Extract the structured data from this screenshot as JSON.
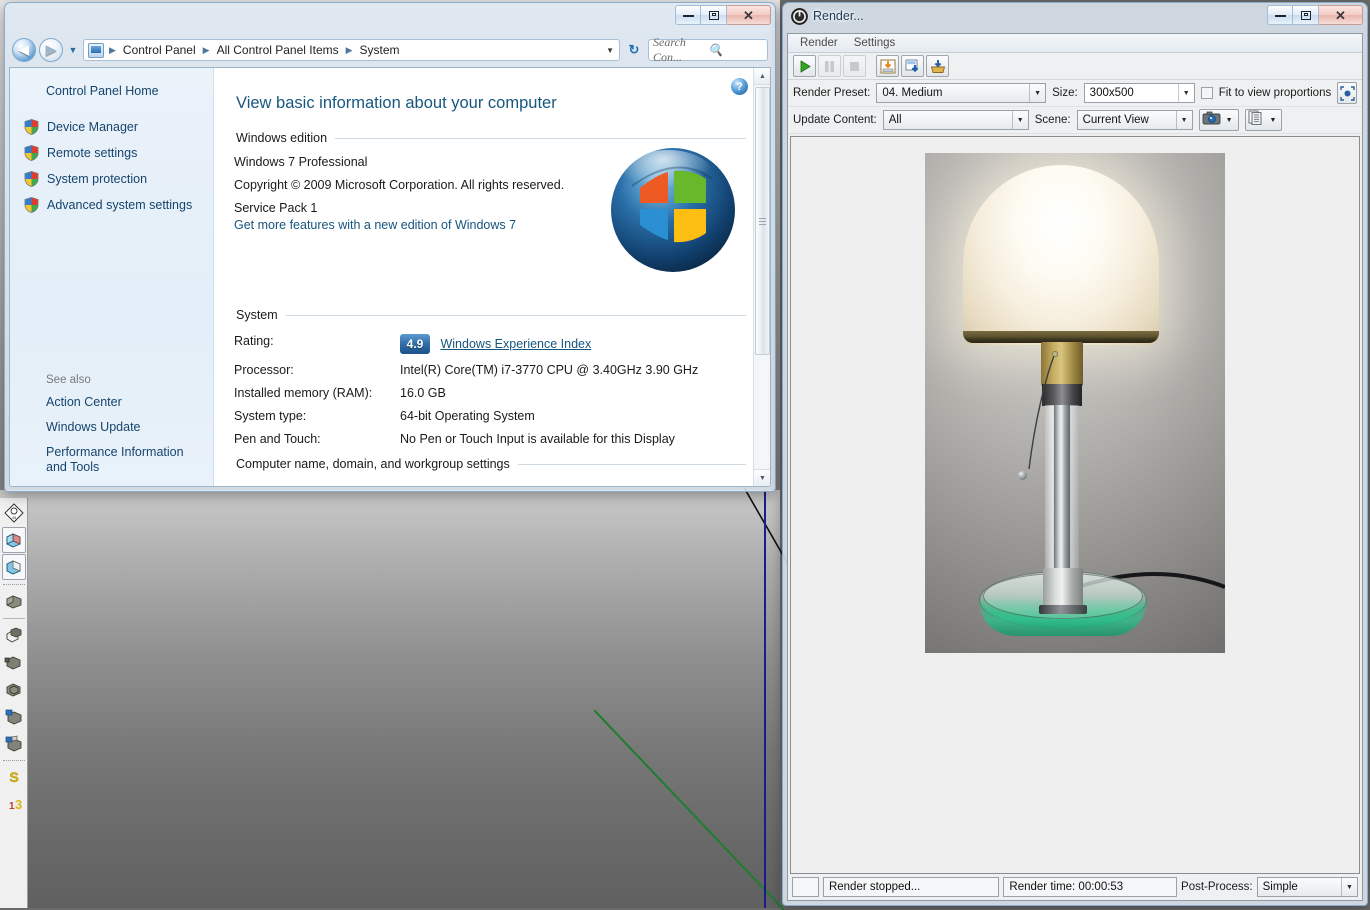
{
  "control_panel": {
    "window_title": "",
    "nav": {
      "back_label": "◀",
      "forward_label": "▶",
      "dropdown_label": "▼",
      "refresh_label": "↻",
      "breadcrumbs": [
        "Control Panel",
        "All Control Panel Items",
        "System"
      ],
      "separator": "▶",
      "caret": "▼"
    },
    "search": {
      "placeholder": "Search Con...",
      "value": "",
      "icon": "search-icon"
    },
    "window_buttons": {
      "minimize": "minimize-icon",
      "maximize": "maximize-icon",
      "close": "close-icon"
    },
    "sidebar": {
      "home_label": "Control Panel Home",
      "items": [
        {
          "label": "Device Manager",
          "icon": "shield-icon"
        },
        {
          "label": "Remote settings",
          "icon": "shield-icon"
        },
        {
          "label": "System protection",
          "icon": "shield-icon"
        },
        {
          "label": "Advanced system settings",
          "icon": "shield-icon"
        }
      ],
      "see_also_title": "See also",
      "see_also_links": [
        "Action Center",
        "Windows Update",
        "Performance Information and Tools"
      ]
    },
    "main": {
      "help_label": "?",
      "heading": "View basic information about your computer",
      "windows_edition": {
        "section_title": "Windows edition",
        "edition": "Windows 7 Professional",
        "copyright": "Copyright © 2009 Microsoft Corporation.  All rights reserved.",
        "service_pack": "Service Pack 1",
        "upgrade_link": "Get more features with a new edition of Windows 7"
      },
      "system": {
        "section_title": "System",
        "rows": [
          {
            "label": "Rating:",
            "value": "",
            "badge": "4.9",
            "link": "Windows Experience Index"
          },
          {
            "label": "Processor:",
            "value": "Intel(R) Core(TM) i7-3770 CPU @ 3.40GHz   3.90 GHz"
          },
          {
            "label": "Installed memory (RAM):",
            "value": "16.0 GB"
          },
          {
            "label": "System type:",
            "value": "64-bit Operating System"
          },
          {
            "label": "Pen and Touch:",
            "value": "No Pen or Touch Input is available for this Display"
          }
        ]
      },
      "computer_name_section": "Computer name, domain, and workgroup settings"
    },
    "scrollbar": {
      "up": "▲",
      "down": "▼"
    }
  },
  "render_window": {
    "title": "Render...",
    "icon": "power-icon",
    "window_buttons": {
      "minimize": "minimize-icon",
      "maximize": "maximize-icon",
      "close": "close-icon"
    },
    "menu": [
      "Render",
      "Settings"
    ],
    "toolbar": [
      {
        "name": "render-start-button",
        "icon": "play-icon"
      },
      {
        "name": "render-pause-button",
        "icon": "pause-icon"
      },
      {
        "name": "render-stop-button",
        "icon": "stop-icon"
      },
      {
        "name": "save-image-button",
        "icon": "save-image-icon"
      },
      {
        "name": "save-render-button",
        "icon": "save-render-icon"
      },
      {
        "name": "export-button",
        "icon": "export-icon"
      }
    ],
    "controls": {
      "render_preset_label": "Render Preset:",
      "render_preset_value": "04. Medium",
      "size_label": "Size:",
      "size_value": "300x500",
      "fit_to_view_label": "Fit to view proportions",
      "fit_to_view_checked": false,
      "lock_aspect_icon": "aspect-lock-icon",
      "update_content_label": "Update Content:",
      "update_content_value": "All",
      "scene_label": "Scene:",
      "scene_value": "Current View",
      "camera_button_icon": "camera-icon",
      "layers_button_icon": "layers-icon",
      "dropdown_caret": "▼"
    },
    "canvas": {
      "alt": "Rendered Wagenfeld Bauhaus table lamp"
    },
    "status": {
      "message": "Render stopped...",
      "render_time": "Render time: 00:00:53",
      "post_process_label": "Post-Process:",
      "post_process_value": "Simple"
    }
  },
  "background_app": {
    "toolbar_tools": [
      {
        "name": "orbit-tool",
        "icon": "axes-icon"
      },
      {
        "name": "solid-tool-1",
        "icon": "solid-box-icon"
      },
      {
        "name": "solid-tool-2",
        "icon": "solid-shape-icon"
      },
      {
        "name": "push-pull-tool",
        "icon": "push-pull-icon"
      },
      {
        "name": "follow-me-tool",
        "icon": "follow-me-icon"
      },
      {
        "name": "scale-tool",
        "icon": "scale-icon"
      },
      {
        "name": "offset-tool",
        "icon": "offset-icon"
      },
      {
        "name": "move-tool",
        "icon": "move-icon"
      },
      {
        "name": "rotate-tool",
        "icon": "rotate-icon"
      },
      {
        "name": "sandbox-tool-1",
        "icon": "sandbox-s-icon"
      },
      {
        "name": "sandbox-tool-2",
        "icon": "sandbox-3-icon"
      }
    ]
  },
  "colors": {
    "accent": "#16557e",
    "link": "#16446e",
    "render_canvas_bg": "#efefef",
    "win7_glass": "#dee9f3",
    "lamp_base_green": "#2fc18c"
  }
}
